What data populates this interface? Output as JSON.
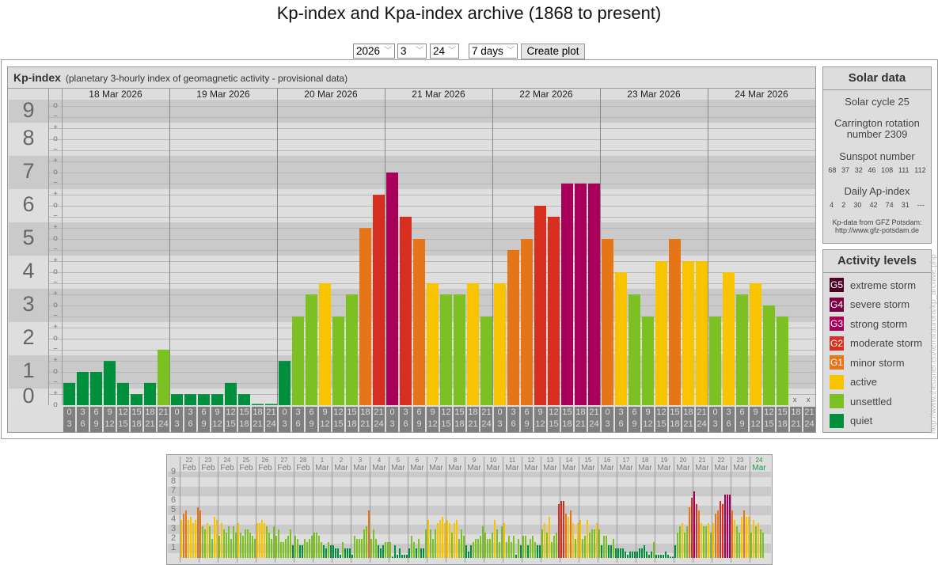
{
  "title": "Kp-index and Kpa-index archive (1868 to present)",
  "controls": {
    "year": "2026",
    "month": "3",
    "day": "24",
    "range": "7 days",
    "create_plot": "Create plot"
  },
  "legend_colors": {
    "G5": "#4b0024",
    "G4": "#7a0043",
    "G3": "#a8005a",
    "G2": "#d62f1f",
    "G1": "#e57517",
    "active": "#f8c400",
    "unsettled": "#7cc022",
    "quiet": "#008f3d"
  },
  "solar": {
    "heading": "Solar data",
    "cycle": "Solar cycle 25",
    "carrington": "Carrington rotation number 2309",
    "sunspot_label": "Sunspot number",
    "sunspots": [
      "68",
      "37",
      "32",
      "46",
      "108",
      "111",
      "112"
    ],
    "ap_label": "Daily Ap-index",
    "ap": [
      "4",
      "2",
      "30",
      "42",
      "74",
      "31",
      "---"
    ],
    "source": "Kp-data from GFZ Potsdam:",
    "source_url": "http://www.gfz-potsdam.de"
  },
  "levels": {
    "heading": "Activity levels",
    "items": [
      {
        "badge": "G5",
        "label": "extreme storm",
        "key": "G5"
      },
      {
        "badge": "G4",
        "label": "severe storm",
        "key": "G4"
      },
      {
        "badge": "G3",
        "label": "strong storm",
        "key": "G3"
      },
      {
        "badge": "G2",
        "label": "moderate storm",
        "key": "G2"
      },
      {
        "badge": "G1",
        "label": "minor storm",
        "key": "G1"
      },
      {
        "badge": "",
        "label": "active",
        "key": "active"
      },
      {
        "badge": "",
        "label": "unsettled",
        "key": "unsettled"
      },
      {
        "badge": "",
        "label": "quiet",
        "key": "quiet"
      }
    ]
  },
  "side_url": "http://www.theusner.eu/terra/aurora/kp_archive.php",
  "chart_data": [
    {
      "type": "bar",
      "title": "Kp-index",
      "subtitle": "(planetary 3-hourly index of geomagnetic activity - provisional data)",
      "ylim": [
        0,
        9
      ],
      "yticks": [
        "0",
        "1",
        "2",
        "3",
        "4",
        "5",
        "6",
        "7",
        "8",
        "9"
      ],
      "sign_symbols": [
        "o",
        "+",
        "−"
      ],
      "missing_mark": "x",
      "slot_labels": [
        [
          "0",
          "3"
        ],
        [
          "3",
          "6"
        ],
        [
          "6",
          "9"
        ],
        [
          "9",
          "12"
        ],
        [
          "12",
          "15"
        ],
        [
          "15",
          "18"
        ],
        [
          "18",
          "21"
        ],
        [
          "21",
          "24"
        ]
      ],
      "days": [
        {
          "label": "18 Mar 2026",
          "values": [
            0.67,
            1,
            1,
            1.33,
            0.67,
            0.33,
            0.67,
            1.67
          ]
        },
        {
          "label": "19 Mar 2026",
          "values": [
            0.33,
            0.33,
            0.33,
            0.33,
            0.67,
            0.33,
            0,
            0
          ]
        },
        {
          "label": "20 Mar 2026",
          "values": [
            1.33,
            2.67,
            3.33,
            3.67,
            2.67,
            3.33,
            5.33,
            6.33
          ]
        },
        {
          "label": "21 Mar 2026",
          "values": [
            7,
            5.67,
            5,
            3.67,
            3.33,
            3.33,
            3.67,
            2.67
          ]
        },
        {
          "label": "22 Mar 2026",
          "values": [
            3.67,
            4.67,
            5,
            6,
            5.67,
            6.67,
            6.67,
            6.67
          ]
        },
        {
          "label": "23 Mar 2026",
          "values": [
            5,
            4,
            3.33,
            2.67,
            4.33,
            5,
            4.33,
            4.33
          ]
        },
        {
          "label": "24 Mar 2026",
          "values": [
            2.67,
            4,
            3.33,
            3.67,
            3,
            2.67,
            null,
            null
          ]
        }
      ]
    },
    {
      "type": "bar",
      "ylim": [
        0,
        9
      ],
      "yticks": [
        "1",
        "2",
        "3",
        "4",
        "5",
        "6",
        "7",
        "8",
        "9"
      ],
      "days": [
        {
          "day": "22",
          "month": "Feb",
          "values": [
            4,
            4.67,
            5,
            4,
            4.33,
            3.67,
            4,
            5.33
          ]
        },
        {
          "day": "23",
          "month": "Feb",
          "values": [
            5,
            3.33,
            3,
            3.67,
            3.33,
            2,
            4.33,
            4
          ]
        },
        {
          "day": "24",
          "month": "Feb",
          "values": [
            2.33,
            3.67,
            3,
            2.67,
            3.33,
            2,
            3.33,
            2.67
          ]
        },
        {
          "day": "25",
          "month": "Feb",
          "values": [
            3.67,
            2.67,
            2.33,
            3,
            3,
            2.67,
            2.33,
            2
          ]
        },
        {
          "day": "26",
          "month": "Feb",
          "values": [
            3.67,
            3.67,
            4,
            3.67,
            3.33,
            2.67,
            2,
            3.33
          ]
        },
        {
          "day": "27",
          "month": "Feb",
          "values": [
            2.33,
            3,
            1.67,
            1.67,
            2,
            2.33,
            3,
            1.33
          ]
        },
        {
          "day": "28",
          "month": "Feb",
          "values": [
            2.33,
            2,
            1.33,
            1.33,
            2,
            1.67,
            2,
            2.33
          ]
        },
        {
          "day": "1",
          "month": "Mar",
          "values": [
            2.67,
            2.67,
            2.33,
            1.67,
            1.33,
            1,
            1.67,
            1.33
          ]
        },
        {
          "day": "2",
          "month": "Mar",
          "values": [
            1.33,
            1,
            1,
            0.33,
            1.67,
            1,
            1,
            1
          ]
        },
        {
          "day": "3",
          "month": "Mar",
          "values": [
            0.33,
            2.33,
            2,
            2,
            2,
            3,
            3.33,
            5
          ]
        },
        {
          "day": "4",
          "month": "Mar",
          "values": [
            2,
            3,
            2,
            1.33,
            1,
            1.33,
            1.67,
            1.67
          ]
        },
        {
          "day": "5",
          "month": "Mar",
          "values": [
            1.67,
            0,
            1.33,
            0.33,
            1,
            0.33,
            0.33,
            0.33
          ]
        },
        {
          "day": "6",
          "month": "Mar",
          "values": [
            1,
            2.33,
            1.67,
            1,
            2,
            1,
            1,
            3
          ]
        },
        {
          "day": "7",
          "month": "Mar",
          "values": [
            4,
            3,
            2,
            3,
            3.67,
            4,
            4.33,
            3.67
          ]
        },
        {
          "day": "8",
          "month": "Mar",
          "values": [
            4,
            3.67,
            2.67,
            3.67,
            4,
            2,
            3,
            2.33
          ]
        },
        {
          "day": "9",
          "month": "Mar",
          "values": [
            1.33,
            0.67,
            1.33,
            1.67,
            2,
            2,
            2.33,
            3.33
          ]
        },
        {
          "day": "10",
          "month": "Mar",
          "values": [
            2.67,
            2,
            2,
            2.67,
            4,
            3,
            1.67,
            3.33
          ]
        },
        {
          "day": "11",
          "month": "Mar",
          "values": [
            3.67,
            1.67,
            2.33,
            1.67,
            2.33,
            0.33,
            2,
            1.33
          ]
        },
        {
          "day": "12",
          "month": "Mar",
          "values": [
            2.33,
            2.33,
            1.33,
            2,
            2.33,
            1.67,
            1.33,
            1.33
          ]
        },
        {
          "day": "13",
          "month": "Mar",
          "values": [
            3,
            3.67,
            2.67,
            4.33,
            1.67,
            2.33,
            2.67,
            5.67
          ]
        },
        {
          "day": "14",
          "month": "Mar",
          "values": [
            6,
            6,
            4.67,
            4.33,
            5,
            3.67,
            2,
            3.67
          ]
        },
        {
          "day": "15",
          "month": "Mar",
          "values": [
            4,
            2,
            2.33,
            4,
            2.67,
            3,
            3,
            3.67
          ]
        },
        {
          "day": "16",
          "month": "Mar",
          "values": [
            3,
            1.33,
            2.33,
            2.33,
            1.33,
            1.33,
            2,
            1
          ]
        },
        {
          "day": "17",
          "month": "Mar",
          "values": [
            1,
            1,
            1,
            0.67,
            0.33,
            0.67,
            0.67,
            0.67
          ]
        },
        {
          "day": "18",
          "month": "Mar",
          "values": [
            0.67,
            1,
            1,
            1.33,
            0.67,
            0.33,
            0.67,
            1.67
          ]
        },
        {
          "day": "19",
          "month": "Mar",
          "values": [
            0.33,
            0.33,
            0.33,
            0.33,
            0.67,
            0.33,
            0,
            0
          ]
        },
        {
          "day": "20",
          "month": "Mar",
          "values": [
            1.33,
            2.67,
            3.33,
            3.67,
            2.67,
            3.33,
            5.33,
            6.33
          ]
        },
        {
          "day": "21",
          "month": "Mar",
          "values": [
            7,
            5.67,
            5,
            3.67,
            3.33,
            3.33,
            3.67,
            2.67
          ]
        },
        {
          "day": "22",
          "month": "Mar",
          "values": [
            3.67,
            4.67,
            5,
            6,
            5.67,
            6.67,
            6.67,
            6.67
          ]
        },
        {
          "day": "23",
          "month": "Mar",
          "values": [
            5,
            4,
            3.33,
            2.67,
            4.33,
            5,
            4.33,
            4.33
          ]
        },
        {
          "day": "24",
          "month": "Mar",
          "current": true,
          "values": [
            2.67,
            4,
            3.33,
            3.67,
            3,
            2.67,
            null,
            null
          ]
        }
      ]
    }
  ]
}
